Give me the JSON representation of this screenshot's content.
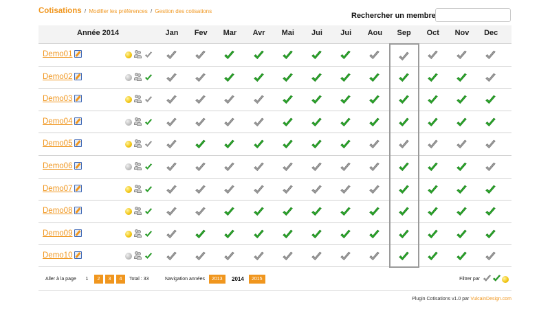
{
  "nav": {
    "title": "Cotisations",
    "links": [
      "Modifier les préférences",
      "Gestion des cotisations"
    ],
    "separator": "/"
  },
  "search": {
    "label": "Rechercher un membre",
    "value": ""
  },
  "table": {
    "year_label": "Année 2014",
    "months": [
      "Jan",
      "Fev",
      "Mar",
      "Avr",
      "Mai",
      "Jui",
      "Jui",
      "Aou",
      "Sep",
      "Oct",
      "Nov",
      "Dec"
    ],
    "selected_month": "Sep",
    "check_colors": {
      "paid": "#2ba82b",
      "unpaid": "#9c9c9c"
    },
    "members": [
      {
        "name": "Demo01",
        "dot": "gold",
        "mini": "unpaid",
        "months": [
          "unpaid",
          "unpaid",
          "paid",
          "paid",
          "paid",
          "paid",
          "paid",
          "unpaid",
          "unpaid",
          "unpaid",
          "unpaid",
          "unpaid"
        ]
      },
      {
        "name": "Demo02",
        "dot": "grey",
        "mini": "paid",
        "months": [
          "unpaid",
          "unpaid",
          "paid",
          "paid",
          "paid",
          "paid",
          "paid",
          "paid",
          "paid",
          "paid",
          "paid",
          "unpaid"
        ]
      },
      {
        "name": "Demo03",
        "dot": "gold",
        "mini": "unpaid",
        "months": [
          "unpaid",
          "unpaid",
          "unpaid",
          "unpaid",
          "paid",
          "paid",
          "paid",
          "paid",
          "paid",
          "paid",
          "paid",
          "paid"
        ]
      },
      {
        "name": "Demo04",
        "dot": "grey",
        "mini": "paid",
        "months": [
          "unpaid",
          "unpaid",
          "unpaid",
          "unpaid",
          "paid",
          "paid",
          "paid",
          "paid",
          "paid",
          "paid",
          "paid",
          "paid"
        ]
      },
      {
        "name": "Demo05",
        "dot": "gold",
        "mini": "unpaid",
        "months": [
          "unpaid",
          "paid",
          "paid",
          "paid",
          "paid",
          "paid",
          "paid",
          "unpaid",
          "unpaid",
          "unpaid",
          "unpaid",
          "unpaid"
        ]
      },
      {
        "name": "Demo06",
        "dot": "grey",
        "mini": "paid",
        "months": [
          "unpaid",
          "unpaid",
          "unpaid",
          "unpaid",
          "unpaid",
          "unpaid",
          "unpaid",
          "unpaid",
          "paid",
          "paid",
          "paid",
          "unpaid"
        ]
      },
      {
        "name": "Demo07",
        "dot": "gold",
        "mini": "paid",
        "months": [
          "unpaid",
          "unpaid",
          "unpaid",
          "unpaid",
          "unpaid",
          "unpaid",
          "unpaid",
          "unpaid",
          "paid",
          "paid",
          "paid",
          "paid"
        ]
      },
      {
        "name": "Demo08",
        "dot": "gold",
        "mini": "paid",
        "months": [
          "unpaid",
          "unpaid",
          "paid",
          "paid",
          "paid",
          "paid",
          "paid",
          "paid",
          "paid",
          "paid",
          "paid",
          "paid"
        ]
      },
      {
        "name": "Demo09",
        "dot": "gold",
        "mini": "paid",
        "months": [
          "unpaid",
          "paid",
          "paid",
          "paid",
          "paid",
          "paid",
          "paid",
          "paid",
          "paid",
          "paid",
          "paid",
          "paid"
        ]
      },
      {
        "name": "Demo10",
        "dot": "grey",
        "mini": "paid",
        "months": [
          "unpaid",
          "unpaid",
          "unpaid",
          "unpaid",
          "unpaid",
          "unpaid",
          "unpaid",
          "unpaid",
          "paid",
          "paid",
          "paid",
          "unpaid"
        ]
      }
    ]
  },
  "footer": {
    "goto_label": "Aller à la page",
    "pages": [
      "1",
      "2",
      "3",
      "4"
    ],
    "current_page": "1",
    "total_label": "Total : 33",
    "year_nav_label": "Navigation années",
    "prev_year": "2013",
    "current_year": "2014",
    "next_year": "2015",
    "filter_label": "Filtrer par"
  },
  "credit": {
    "text": "Plugin Cotisations v1.0 par",
    "link": "VulcainDesign.com"
  }
}
